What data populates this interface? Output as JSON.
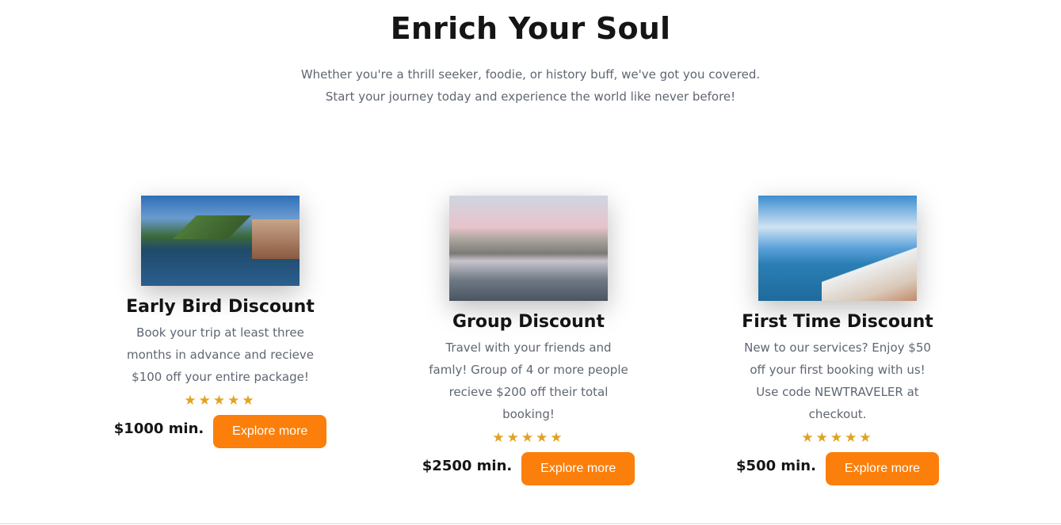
{
  "header": {
    "title": "Enrich Your Soul",
    "subtitle_lines": [
      "Whether you're a thrill seeker, foodie, or history buff, we've got you covered.",
      "Start your journey today and experience the world like never before!"
    ]
  },
  "cards": [
    {
      "title": "Early Bird Discount",
      "description": "Book your trip at least three months in advance and recieve $100 off your entire package!",
      "rating": 5,
      "stars": "★★★★★",
      "price": "$1000 min.",
      "button": "Explore more",
      "image": "lake-village-mountains"
    },
    {
      "title": "Group Discount",
      "description": "Travel with your friends and famly! Group of 4 or more people recieve $200 off their total booking!",
      "rating": 5,
      "stars": "★★★★★",
      "price": "$2500 min.",
      "button": "Explore more",
      "image": "city-square-reflection"
    },
    {
      "title": "First Time Discount",
      "description": "New to our services? Enjoy $50 off your first booking with us! Use code NEWTRAVELER at checkout.",
      "rating": 5,
      "stars": "★★★★★",
      "price": "$500 min.",
      "button": "Explore more",
      "image": "coastal-white-town"
    }
  ],
  "colors": {
    "accent": "#fb7f0a",
    "star": "#e0a323",
    "text": "#151515",
    "muted": "#5f6672"
  }
}
